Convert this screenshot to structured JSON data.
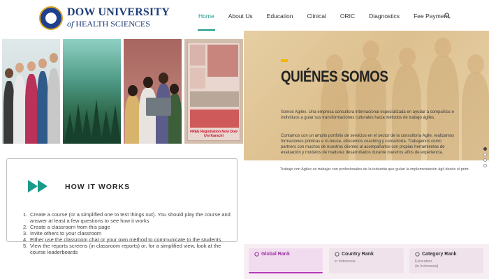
{
  "header": {
    "brand_line1": "DOW UNIVERSITY",
    "brand_of": "of",
    "brand_line2": "HEALTH SCIENCES",
    "nav": [
      {
        "label": "Home",
        "active": true
      },
      {
        "label": "About Us",
        "active": false
      },
      {
        "label": "Education",
        "active": false
      },
      {
        "label": "Clinical",
        "active": false
      },
      {
        "label": "ORIC",
        "active": false
      },
      {
        "label": "Diagnostics",
        "active": false
      },
      {
        "label": "Fee Payment",
        "active": false
      }
    ],
    "accent_color": "#1a9a8a"
  },
  "photos": {
    "poster_text": "FREE Registration Now Dow Uni Karachi"
  },
  "hero": {
    "title": "QUIÉNES SOMOS",
    "paragraph1": "Somos Agilex. Una empresa consultora internacional especializada en ayudar a compañías e individuos a guiar sus transformaciones culturales hacia métodos de trabajo ágiles.",
    "paragraph2": "Contamos con un amplio portfolio de servicios en el sector de la consultoría Agile, realizamos formaciones públicas e in-house, ofrecemos coaching y consultoría. Trabajamos como partners con muchos de nuestros clientes al acompañarlos con propias herramientas de evaluación y modelos de madurez desarrollados durante nuestros años de experiencia.",
    "after_text": "Trabajo con Agilex es trabajar con profesionales de la industria que guían la implementación ágil desde el primer día.",
    "accent_color": "#f2b705"
  },
  "how_it_works": {
    "title": "HOW IT WORKS",
    "steps": [
      {
        "num": "1.",
        "text": "Create a course (or a simplified one to test things out). You should play the course and answer at least a few questions to see how it works"
      },
      {
        "num": "2.",
        "text": "Create a classroom from this page"
      },
      {
        "num": "3.",
        "text": "Invite others to your classroom"
      },
      {
        "num": "4.",
        "text": "Either use the classroom chat or your own method to communicate to the students"
      },
      {
        "num": "5.",
        "text": "View the reports screens (in classroom reports) or, for a simplified view, look at the course leaderboards"
      }
    ],
    "icon_color": "#1a9a8a"
  },
  "ranks": [
    {
      "title": "Global Rank",
      "line1": "",
      "line2": "",
      "active": true
    },
    {
      "title": "Country Rank",
      "line1": "in Indonesia",
      "line2": "",
      "active": false
    },
    {
      "title": "Category Rank",
      "line1": "Education",
      "line2": "(in Indonesia)",
      "active": false
    }
  ],
  "slider_dots": {
    "count": 4,
    "active_index": 0
  },
  "icons": {
    "search": "search-icon",
    "play": "double-play-icon",
    "rank": "trophy-icon"
  }
}
